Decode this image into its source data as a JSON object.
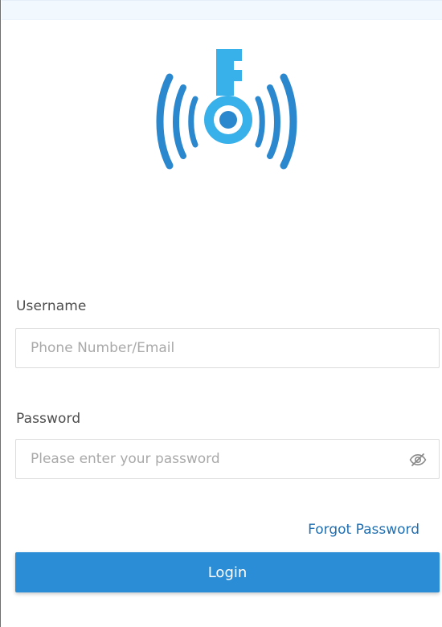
{
  "logo": {
    "icon": "wireless-key-icon",
    "colors": {
      "wave": "#2b88ce",
      "key": "#38b0ea",
      "center": "#2b88ce"
    }
  },
  "form": {
    "username": {
      "label": "Username",
      "placeholder": "Phone Number/Email",
      "value": ""
    },
    "password": {
      "label": "Password",
      "placeholder": "Please enter your password",
      "value": "",
      "toggle_icon": "eye-off-icon"
    },
    "forgot_password_label": "Forgot Password",
    "login_label": "Login"
  },
  "colors": {
    "accent": "#2a8dd6",
    "link": "#1f6fb2",
    "top_strip": "#f1f8fe"
  }
}
